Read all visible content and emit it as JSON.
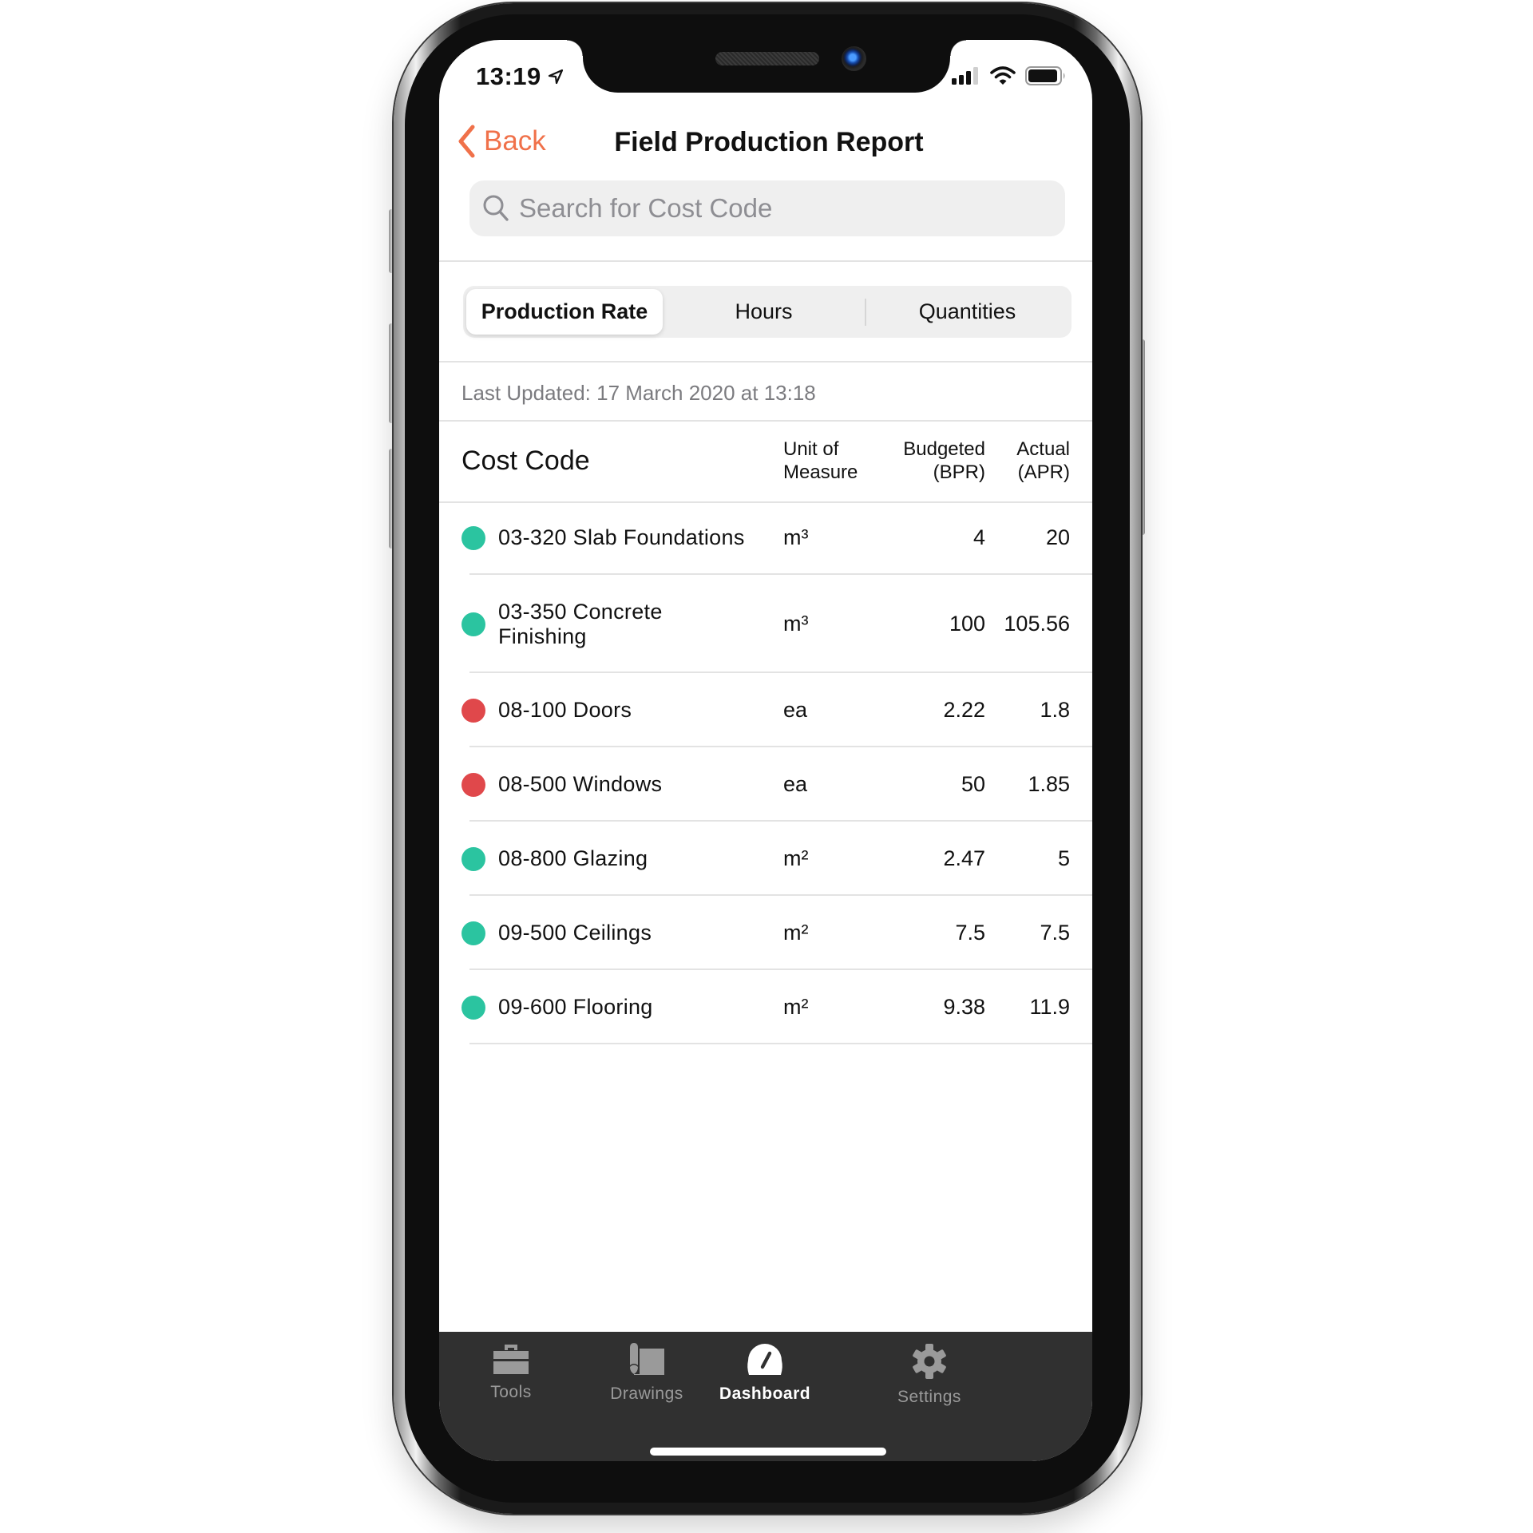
{
  "status_bar": {
    "time": "13:19",
    "icons": [
      "location-arrow-icon",
      "cellular-signal-icon",
      "wifi-icon",
      "battery-icon"
    ]
  },
  "nav": {
    "back_label": "Back",
    "title": "Field Production Report"
  },
  "search": {
    "placeholder": "Search for Cost Code",
    "value": ""
  },
  "segments": {
    "items": [
      {
        "label": "Production Rate",
        "selected": true
      },
      {
        "label": "Hours",
        "selected": false
      },
      {
        "label": "Quantities",
        "selected": false
      }
    ]
  },
  "last_updated": "Last Updated: 17 March 2020 at 13:18",
  "table": {
    "headers": {
      "cost_code": "Cost Code",
      "uom_line1": "Unit of",
      "uom_line2": "Measure",
      "bpr_line1": "Budgeted",
      "bpr_line2": "(BPR)",
      "apr_line1": "Actual",
      "apr_line2": "(APR)"
    },
    "status_colors": {
      "on_track": "#2bc4a0",
      "behind": "#e0484b"
    },
    "rows": [
      {
        "status": "on_track",
        "name": "03-320 Slab Foundations",
        "uom": "m³",
        "bpr": "4",
        "apr": "20"
      },
      {
        "status": "on_track",
        "name": "03-350 Concrete Finishing",
        "uom": "m³",
        "bpr": "100",
        "apr": "105.56"
      },
      {
        "status": "behind",
        "name": "08-100 Doors",
        "uom": "ea",
        "bpr": "2.22",
        "apr": "1.8"
      },
      {
        "status": "behind",
        "name": "08-500 Windows",
        "uom": "ea",
        "bpr": "50",
        "apr": "1.85"
      },
      {
        "status": "on_track",
        "name": "08-800 Glazing",
        "uom": "m²",
        "bpr": "2.47",
        "apr": "5"
      },
      {
        "status": "on_track",
        "name": "09-500 Ceilings",
        "uom": "m²",
        "bpr": "7.5",
        "apr": "7.5"
      },
      {
        "status": "on_track",
        "name": "09-600 Flooring",
        "uom": "m²",
        "bpr": "9.38",
        "apr": "11.9"
      }
    ]
  },
  "tabbar": {
    "items": [
      {
        "label": "Tools",
        "icon": "toolbox-icon",
        "active": false
      },
      {
        "label": "Drawings",
        "icon": "drawing-scroll-icon",
        "active": false
      },
      {
        "label": "Dashboard",
        "icon": "gauge-icon",
        "active": true
      },
      {
        "label": "Settings",
        "icon": "gear-icon",
        "active": false
      }
    ]
  },
  "colors": {
    "accent": "#f0714a",
    "tabbar_bg": "#303030"
  }
}
